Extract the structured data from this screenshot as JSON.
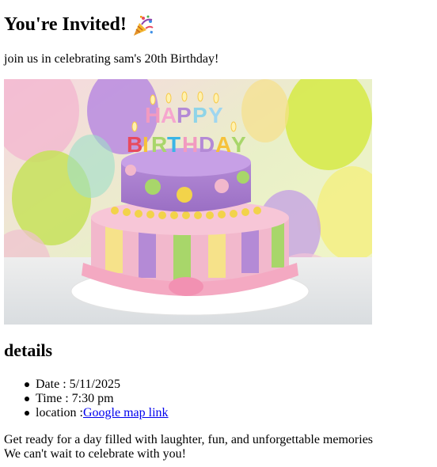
{
  "heading": {
    "title": "You're Invited!",
    "icon": "party-popper-icon"
  },
  "intro_text": "join us in celebrating sam's 20th Birthday!",
  "image": {
    "subject": "birthday-cake-image",
    "candles_text": [
      "HAPPY",
      "BIRTHDAY"
    ]
  },
  "details": {
    "heading": "details",
    "items": [
      {
        "label": "Date",
        "separator": " : ",
        "value": "5/11/2025"
      },
      {
        "label": "Time",
        "separator": " : ",
        "value": "7:30 pm"
      },
      {
        "label": "location",
        "separator": " :",
        "link_text": "Google map link"
      }
    ]
  },
  "closing": {
    "line1": "Get ready for a day filled with laughter, fun, and unforgettable memories",
    "line2": "We can't wait to celebrate with you!"
  },
  "colors": {
    "link": "#0000ee",
    "text": "#000000"
  }
}
